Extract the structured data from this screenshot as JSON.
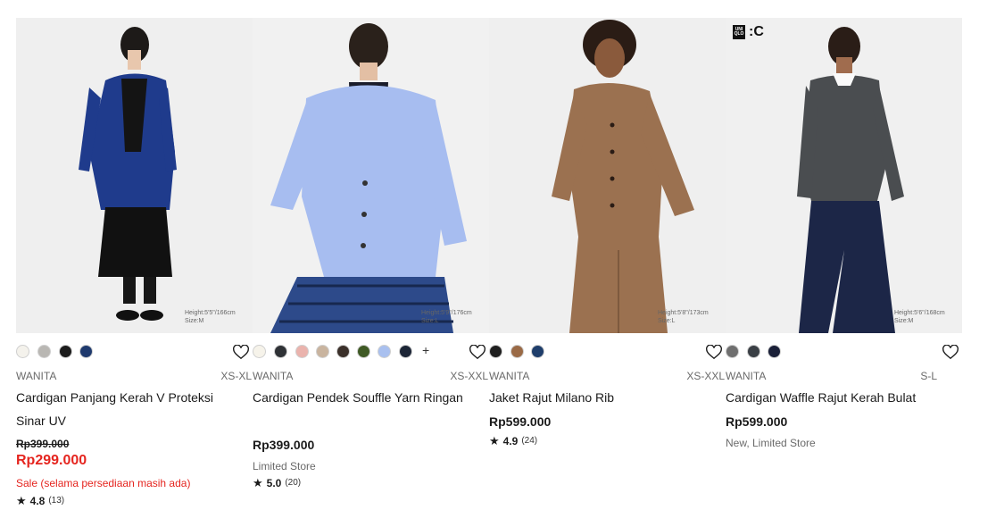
{
  "products": [
    {
      "gender": "WANITA",
      "sizes": "XS-XL",
      "name": "Cardigan Panjang Kerah V Proteksi Sinar UV",
      "old_price": "Rp399.000",
      "sale_price": "Rp299.000",
      "sale_note": "Sale (selama persediaan masih ada)",
      "rating": "4.8",
      "review_count": "(13)",
      "model_note": "Height:5'5\"/166cm\nSize:M",
      "colors": [
        "#f4f2ec",
        "#b9b7b3",
        "#1c1c1c",
        "#1f3a6e"
      ]
    },
    {
      "gender": "WANITA",
      "sizes": "XS-XXL",
      "name": "Cardigan Pendek Souffle Yarn Ringan",
      "price": "Rp399.000",
      "note": "Limited Store",
      "rating": "5.0",
      "review_count": "(20)",
      "model_note": "Height:5'9\"/176cm\nSize:L",
      "colors": [
        "#f6f3ea",
        "#2f3236",
        "#eab3ad",
        "#c9b49f",
        "#3b302a",
        "#3f5a25",
        "#a9c0ef",
        "#1c2536"
      ],
      "more_colors": "+"
    },
    {
      "gender": "WANITA",
      "sizes": "XS-XXL",
      "name": "Jaket Rajut Milano Rib",
      "price": "Rp599.000",
      "rating": "4.9",
      "review_count": "(24)",
      "model_note": "Height:5'8\"/173cm\nSize:L",
      "colors": [
        "#1f1f1f",
        "#9a6a46",
        "#1f3e6b"
      ]
    },
    {
      "gender": "WANITA",
      "sizes": "S-L",
      "name": "Cardigan Waffle Rajut Kerah Bulat",
      "price": "Rp599.000",
      "note": "New, Limited Store",
      "model_note": "Height:5'6\"/168cm\nSize:M",
      "brand_badge": {
        "box": "UNI QLO",
        "letter": ":C"
      },
      "colors": [
        "#6f6f6f",
        "#3a3f45",
        "#1a2038"
      ]
    }
  ],
  "accent_colors": {
    "sale": "#e5251f",
    "text": "#1b1b1b",
    "muted": "#6a6a6a"
  },
  "icons": {
    "favorite": "heart-outline-icon",
    "rating": "star-icon"
  }
}
